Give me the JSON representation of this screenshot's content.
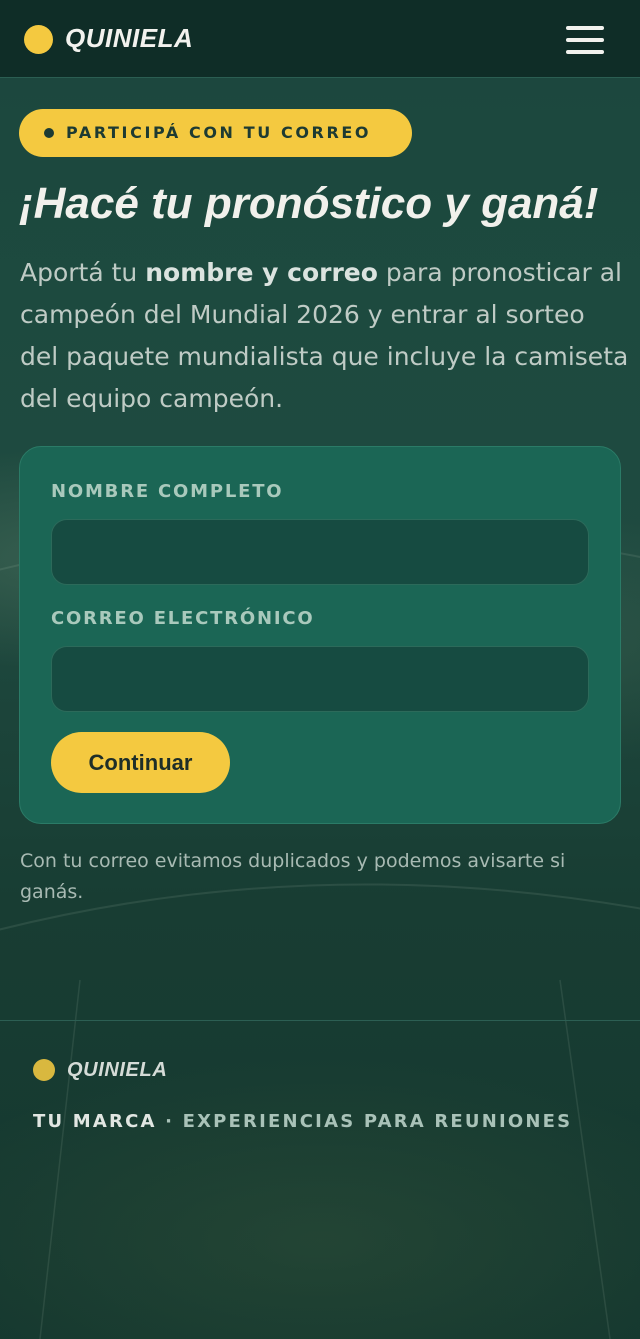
{
  "header": {
    "brand": "QUINIELA",
    "menu_icon": "hamburger-menu-icon"
  },
  "badge": {
    "text": "PARTICIPÁ CON TU CORREO"
  },
  "hero": {
    "headline": "¡Hacé tu pronóstico y ganá!",
    "lead_prefix": "Aportá tu ",
    "lead_bold": "nombre y correo",
    "lead_suffix": " para pronosticar al campeón del Mundial 2026 y entrar al sorteo del paquete mundialista que incluye la camiseta del equipo campeón."
  },
  "form": {
    "name_label": "NOMBRE COMPLETO",
    "name_value": "",
    "name_placeholder": "",
    "email_label": "CORREO ELECTRÓNICO",
    "email_value": "",
    "email_placeholder": "",
    "submit_label": "Continuar"
  },
  "note": "Con tu correo evitamos duplicados y podemos avisarte si ganás.",
  "footer": {
    "brand": "QUINIELA",
    "tagline_brand": "TU MARCA",
    "tagline_separator": " · ",
    "tagline_text": "EXPERIENCIAS PARA REUNIONES"
  },
  "colors": {
    "accent": "#f4c940",
    "card": "#1b6655",
    "background": "#1b463d"
  }
}
